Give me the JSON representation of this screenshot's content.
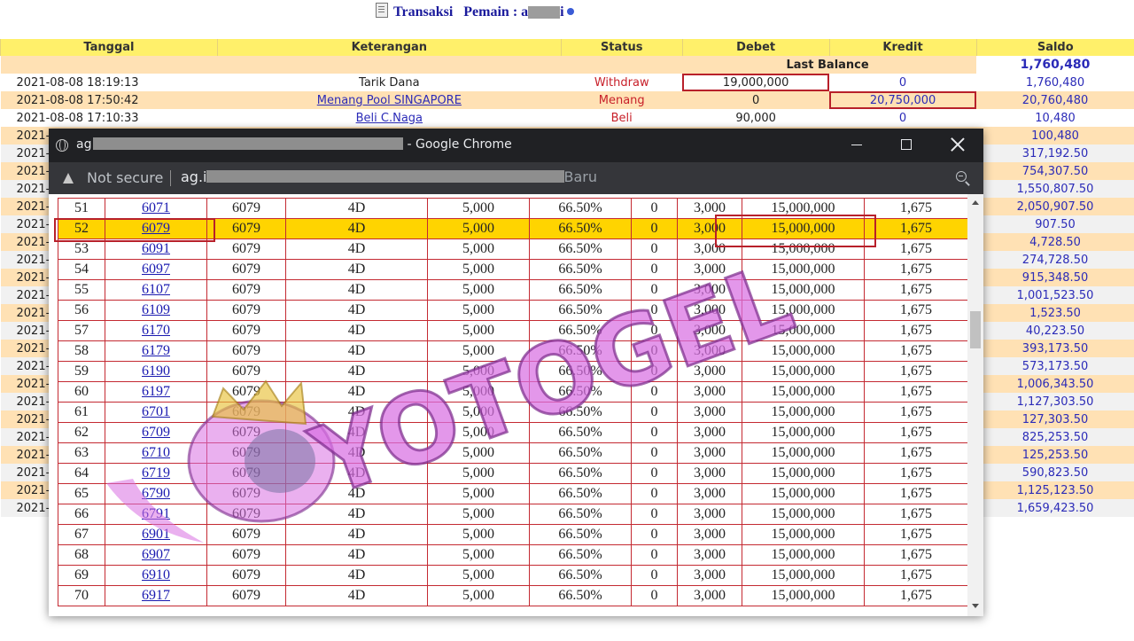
{
  "page_title": {
    "prefix": "Transaksi",
    "label": "Pemain : a",
    "suffix": "i"
  },
  "transactions": {
    "columns": [
      "Tanggal",
      "Keterangan",
      "Status",
      "Debet",
      "Kredit",
      "Saldo"
    ],
    "last_balance_label": "Last Balance",
    "last_balance_value": "1,760,480",
    "rows": [
      {
        "date": "2021-08-08 18:19:13",
        "ket": "Tarik Dana",
        "link": false,
        "status": "Withdraw",
        "debet": "19,000,000",
        "kredit": "0",
        "saldo": "1,760,480"
      },
      {
        "date": "2021-08-08 17:50:42",
        "ket": "Menang Pool SINGAPORE",
        "link": true,
        "status": "Menang",
        "debet": "0",
        "kredit": "20,750,000",
        "saldo": "20,760,480"
      },
      {
        "date": "2021-08-08 17:10:33",
        "ket": "Beli C.Naga",
        "link": true,
        "status": "Beli",
        "debet": "90,000",
        "kredit": "0",
        "saldo": "10,480"
      },
      {
        "date": "2021-",
        "saldo": "100,480"
      },
      {
        "date": "2021-",
        "saldo": "317,192.50"
      },
      {
        "date": "2021-",
        "saldo": "754,307.50"
      },
      {
        "date": "2021-",
        "saldo": "1,550,807.50"
      },
      {
        "date": "2021-",
        "saldo": "2,050,907.50"
      },
      {
        "date": "2021-",
        "saldo": "907.50"
      },
      {
        "date": "2021-",
        "saldo": "4,728.50"
      },
      {
        "date": "2021-",
        "saldo": "274,728.50"
      },
      {
        "date": "2021-",
        "saldo": "915,348.50"
      },
      {
        "date": "2021-",
        "saldo": "1,001,523.50"
      },
      {
        "date": "2021-",
        "saldo": "1,523.50"
      },
      {
        "date": "2021-",
        "saldo": "40,223.50"
      },
      {
        "date": "2021-",
        "saldo": "393,173.50"
      },
      {
        "date": "2021-",
        "saldo": "573,173.50"
      },
      {
        "date": "2021-",
        "saldo": "1,006,343.50"
      },
      {
        "date": "2021-",
        "saldo": "1,127,303.50"
      },
      {
        "date": "2021-",
        "saldo": "127,303.50"
      },
      {
        "date": "2021-",
        "saldo": "825,253.50"
      },
      {
        "date": "2021-",
        "saldo": "125,253.50"
      },
      {
        "date": "2021-",
        "saldo": "590,823.50"
      },
      {
        "date": "2021-",
        "saldo": "1,125,123.50"
      },
      {
        "date": "2021-",
        "saldo": "1,659,423.50"
      }
    ]
  },
  "popup": {
    "window_title_prefix": "ag",
    "window_title_suffix": "- Google Chrome",
    "not_secure": "Not secure",
    "url_prefix": "ag.i",
    "url_suffix": "Baru",
    "icons": {
      "site": "globe-icon",
      "minimize": "minimize-icon",
      "maximize": "maximize-icon",
      "close": "close-icon",
      "warning": "warning-icon",
      "zoom": "zoom-icon"
    },
    "highlight_row": "52",
    "bets": [
      {
        "no": "51",
        "number": "6071",
        "result": "6079",
        "game": "4D",
        "bet": "5,000",
        "disc": "66.50%",
        "c7": "0",
        "pay": "3,000",
        "win": "15,000,000",
        "last": "1,675"
      },
      {
        "no": "52",
        "number": "6079",
        "result": "6079",
        "game": "4D",
        "bet": "5,000",
        "disc": "66.50%",
        "c7": "0",
        "pay": "3,000",
        "win": "15,000,000",
        "last": "1,675"
      },
      {
        "no": "53",
        "number": "6091",
        "result": "6079",
        "game": "4D",
        "bet": "5,000",
        "disc": "66.50%",
        "c7": "0",
        "pay": "3,000",
        "win": "15,000,000",
        "last": "1,675"
      },
      {
        "no": "54",
        "number": "6097",
        "result": "6079",
        "game": "4D",
        "bet": "5,000",
        "disc": "66.50%",
        "c7": "0",
        "pay": "3,000",
        "win": "15,000,000",
        "last": "1,675"
      },
      {
        "no": "55",
        "number": "6107",
        "result": "6079",
        "game": "4D",
        "bet": "5,000",
        "disc": "66.50%",
        "c7": "0",
        "pay": "3,000",
        "win": "15,000,000",
        "last": "1,675"
      },
      {
        "no": "56",
        "number": "6109",
        "result": "6079",
        "game": "4D",
        "bet": "5,000",
        "disc": "66.50%",
        "c7": "0",
        "pay": "3,000",
        "win": "15,000,000",
        "last": "1,675"
      },
      {
        "no": "57",
        "number": "6170",
        "result": "6079",
        "game": "4D",
        "bet": "5,000",
        "disc": "66.50%",
        "c7": "0",
        "pay": "3,000",
        "win": "15,000,000",
        "last": "1,675"
      },
      {
        "no": "58",
        "number": "6179",
        "result": "6079",
        "game": "4D",
        "bet": "5,000",
        "disc": "66.50%",
        "c7": "0",
        "pay": "3,000",
        "win": "15,000,000",
        "last": "1,675"
      },
      {
        "no": "59",
        "number": "6190",
        "result": "6079",
        "game": "4D",
        "bet": "5,000",
        "disc": "66.50%",
        "c7": "0",
        "pay": "3,000",
        "win": "15,000,000",
        "last": "1,675"
      },
      {
        "no": "60",
        "number": "6197",
        "result": "6079",
        "game": "4D",
        "bet": "5,000",
        "disc": "66.50%",
        "c7": "0",
        "pay": "3,000",
        "win": "15,000,000",
        "last": "1,675"
      },
      {
        "no": "61",
        "number": "6701",
        "result": "6079",
        "game": "4D",
        "bet": "5,000",
        "disc": "66.50%",
        "c7": "0",
        "pay": "3,000",
        "win": "15,000,000",
        "last": "1,675"
      },
      {
        "no": "62",
        "number": "6709",
        "result": "6079",
        "game": "4D",
        "bet": "5,000",
        "disc": "66.50%",
        "c7": "0",
        "pay": "3,000",
        "win": "15,000,000",
        "last": "1,675"
      },
      {
        "no": "63",
        "number": "6710",
        "result": "6079",
        "game": "4D",
        "bet": "5,000",
        "disc": "66.50%",
        "c7": "0",
        "pay": "3,000",
        "win": "15,000,000",
        "last": "1,675"
      },
      {
        "no": "64",
        "number": "6719",
        "result": "6079",
        "game": "4D",
        "bet": "5,000",
        "disc": "66.50%",
        "c7": "0",
        "pay": "3,000",
        "win": "15,000,000",
        "last": "1,675"
      },
      {
        "no": "65",
        "number": "6790",
        "result": "6079",
        "game": "4D",
        "bet": "5,000",
        "disc": "66.50%",
        "c7": "0",
        "pay": "3,000",
        "win": "15,000,000",
        "last": "1,675"
      },
      {
        "no": "66",
        "number": "6791",
        "result": "6079",
        "game": "4D",
        "bet": "5,000",
        "disc": "66.50%",
        "c7": "0",
        "pay": "3,000",
        "win": "15,000,000",
        "last": "1,675"
      },
      {
        "no": "67",
        "number": "6901",
        "result": "6079",
        "game": "4D",
        "bet": "5,000",
        "disc": "66.50%",
        "c7": "0",
        "pay": "3,000",
        "win": "15,000,000",
        "last": "1,675"
      },
      {
        "no": "68",
        "number": "6907",
        "result": "6079",
        "game": "4D",
        "bet": "5,000",
        "disc": "66.50%",
        "c7": "0",
        "pay": "3,000",
        "win": "15,000,000",
        "last": "1,675"
      },
      {
        "no": "69",
        "number": "6910",
        "result": "6079",
        "game": "4D",
        "bet": "5,000",
        "disc": "66.50%",
        "c7": "0",
        "pay": "3,000",
        "win": "15,000,000",
        "last": "1,675"
      },
      {
        "no": "70",
        "number": "6917",
        "result": "6079",
        "game": "4D",
        "bet": "5,000",
        "disc": "66.50%",
        "c7": "0",
        "pay": "3,000",
        "win": "15,000,000",
        "last": "1,675"
      }
    ]
  },
  "watermark": {
    "text": "YOTOGEL",
    "color": "#d86fe2"
  },
  "colors": {
    "header_yellow": "#fff06a",
    "row_peach": "#ffe1b4",
    "highlight_gold": "#ffd400",
    "link_blue": "#2b2bb8",
    "status_red": "#c8202a",
    "chrome_dark": "#202124"
  }
}
